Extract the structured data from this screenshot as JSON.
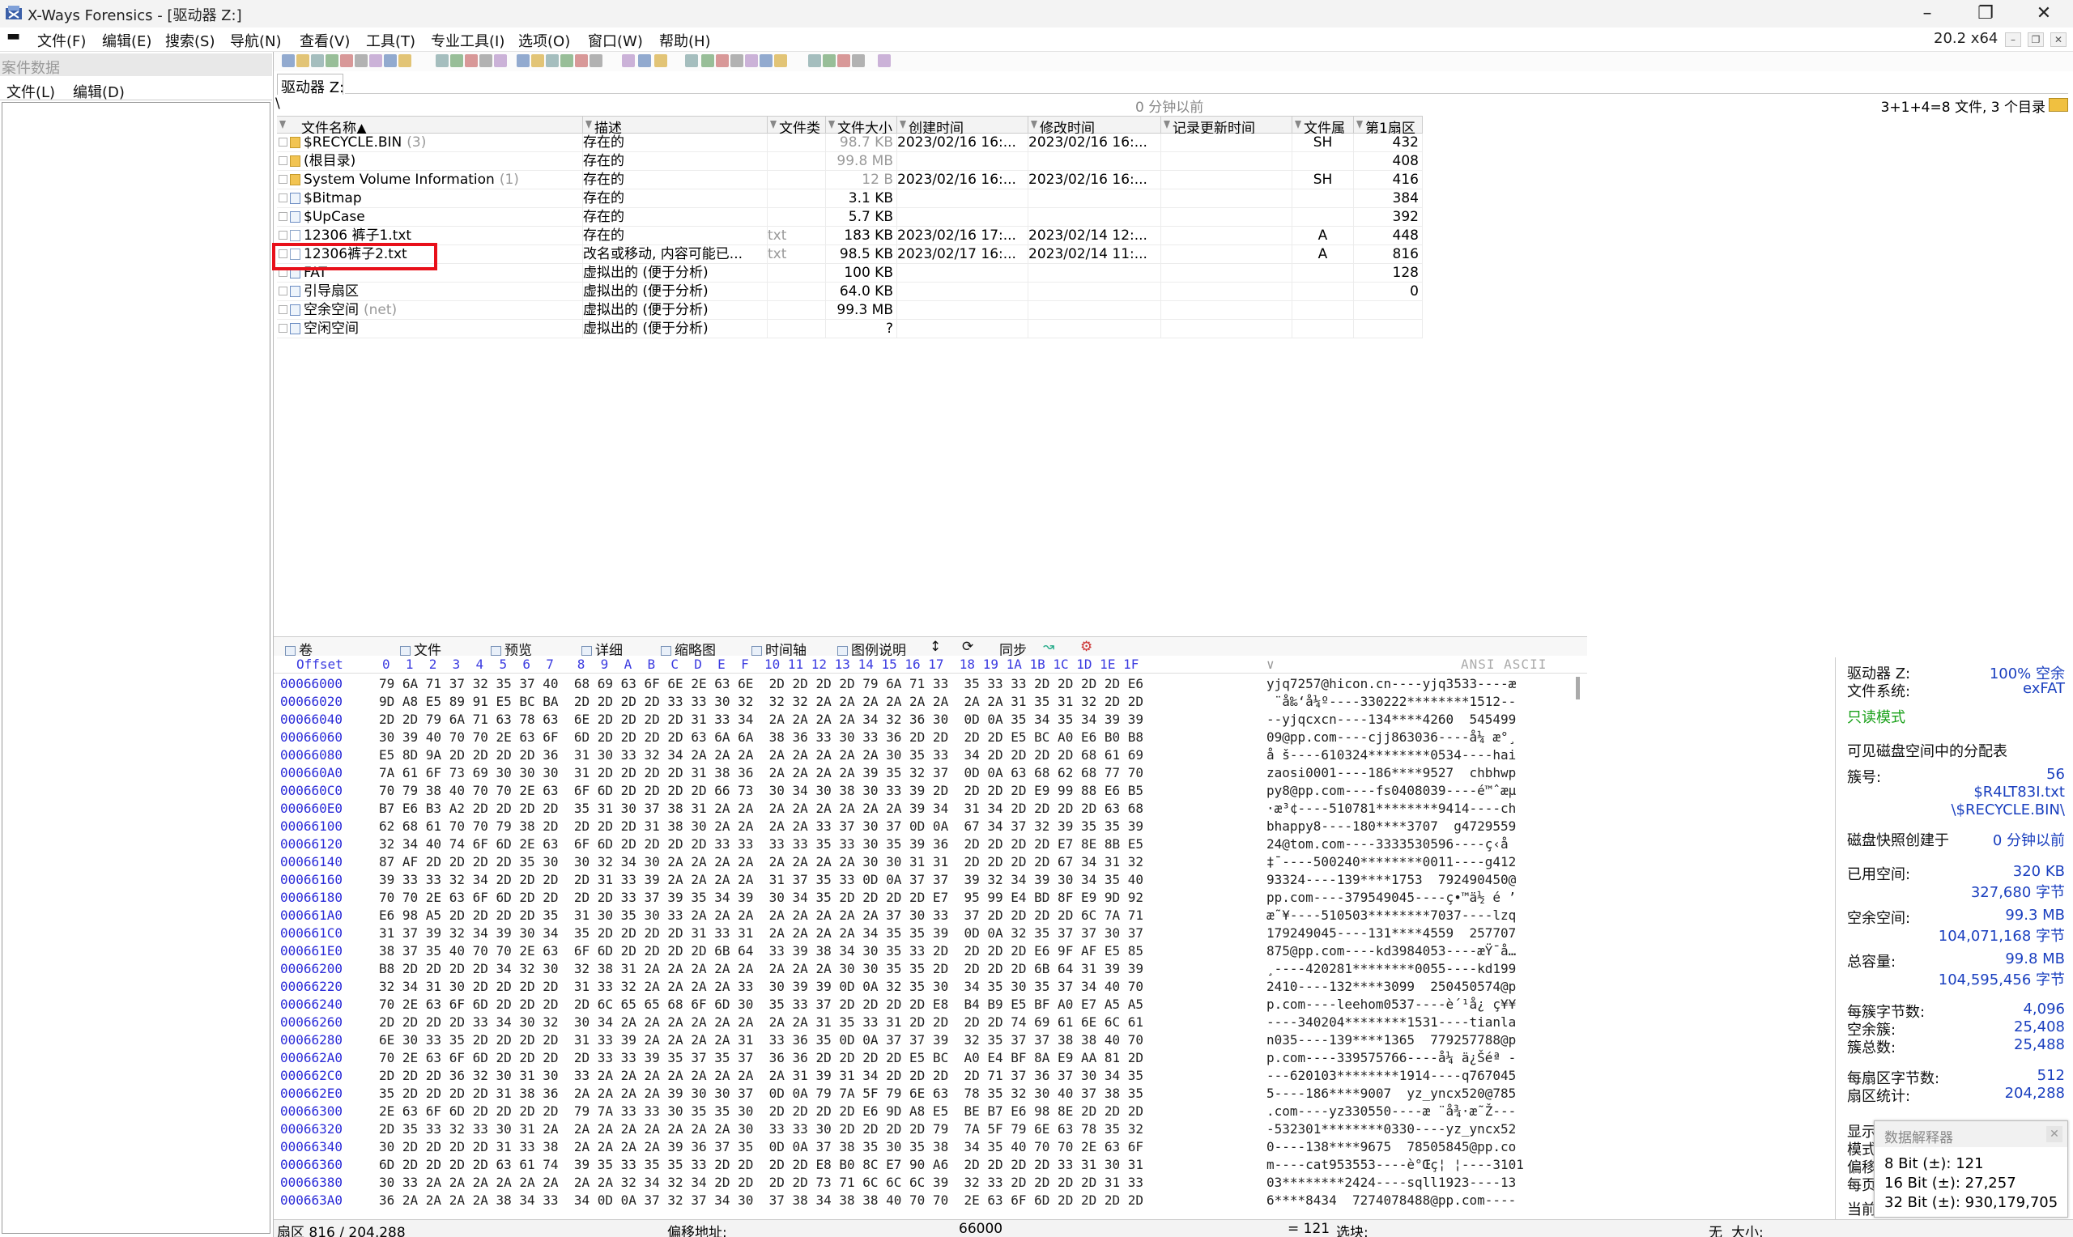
{
  "window": {
    "title": "X-Ways Forensics - [驱动器 Z:]",
    "minimize": "–",
    "maximize": "❐",
    "close": "✕",
    "version": "20.2 x64"
  },
  "menu": [
    "文件(F)",
    "编辑(E)",
    "搜索(S)",
    "导航(N)",
    "查看(V)",
    "工具(T)",
    "专业工具(I)",
    "选项(O)",
    "窗口(W)",
    "帮助(H)"
  ],
  "left_pane": {
    "header": "案件数据",
    "menu": [
      "文件(L)",
      "编辑(D)"
    ]
  },
  "path": {
    "drive_tab": "驱动器 Z:",
    "current": "\\",
    "ago": "0 分钟以前",
    "count": "3+1+4=8 文件, 3 个目录"
  },
  "file_table": {
    "headers": [
      "文件名称▲",
      "描述",
      "文件类",
      "文件大小",
      "创建时间",
      "修改时间",
      "记录更新时间",
      "文件属",
      "第1扇区"
    ],
    "rows": [
      {
        "name": "$RECYCLE.BIN",
        "extra": "(3)",
        "icon": "folder",
        "desc": "存在的",
        "type": "",
        "size": "98.7 KB",
        "size_grey": true,
        "created": "2023/02/16  16:...",
        "modified": "2023/02/16  16:...",
        "updated": "",
        "attr": "SH",
        "sector": "432"
      },
      {
        "name": "(根目录)",
        "extra": "",
        "icon": "folder",
        "desc": "存在的",
        "type": "",
        "size": "99.8 MB",
        "size_grey": true,
        "created": "",
        "modified": "",
        "updated": "",
        "attr": "",
        "sector": "408"
      },
      {
        "name": "System Volume Information",
        "extra": "(1)",
        "icon": "folder",
        "desc": "存在的",
        "type": "",
        "size": "12 B",
        "size_grey": true,
        "created": "2023/02/16  16:...",
        "modified": "2023/02/16  16:...",
        "updated": "",
        "attr": "SH",
        "sector": "416"
      },
      {
        "name": "$Bitmap",
        "extra": "",
        "icon": "virt",
        "desc": "存在的",
        "type": "",
        "size": "3.1 KB",
        "size_grey": false,
        "created": "",
        "modified": "",
        "updated": "",
        "attr": "",
        "sector": "384"
      },
      {
        "name": "$UpCase",
        "extra": "",
        "icon": "virt",
        "desc": "存在的",
        "type": "",
        "size": "5.7 KB",
        "size_grey": false,
        "created": "",
        "modified": "",
        "updated": "",
        "attr": "",
        "sector": "392"
      },
      {
        "name": "12306 裤子1.txt",
        "extra": "",
        "icon": "file",
        "desc": "存在的",
        "type": "txt",
        "size": "183 KB",
        "size_grey": false,
        "created": "2023/02/16  17:...",
        "modified": "2023/02/14  12:...",
        "updated": "",
        "attr": "A",
        "sector": "448"
      },
      {
        "name": "12306裤子2.txt",
        "extra": "",
        "icon": "file",
        "desc": "改名或移动, 内容可能已...",
        "type": "txt",
        "size": "98.5 KB",
        "size_grey": false,
        "created": "2023/02/17  16:...",
        "modified": "2023/02/14  11:...",
        "updated": "",
        "attr": "A",
        "sector": "816"
      },
      {
        "name": "FAT",
        "extra": "",
        "icon": "virt",
        "desc": "虚拟出的 (便于分析)",
        "type": "",
        "size": "100 KB",
        "size_grey": false,
        "created": "",
        "modified": "",
        "updated": "",
        "attr": "",
        "sector": "128"
      },
      {
        "name": "引导扇区",
        "extra": "",
        "icon": "virt",
        "desc": "虚拟出的 (便于分析)",
        "type": "",
        "size": "64.0 KB",
        "size_grey": false,
        "created": "",
        "modified": "",
        "updated": "",
        "attr": "",
        "sector": "0"
      },
      {
        "name": "空余空间",
        "extra": "(net)",
        "icon": "virt",
        "desc": "虚拟出的 (便于分析)",
        "type": "",
        "size": "99.3 MB",
        "size_grey": false,
        "created": "",
        "modified": "",
        "updated": "",
        "attr": "",
        "sector": ""
      },
      {
        "name": "空闲空间",
        "extra": "",
        "icon": "virt",
        "desc": "虚拟出的 (便于分析)",
        "type": "",
        "size": "?",
        "size_grey": false,
        "created": "",
        "modified": "",
        "updated": "",
        "attr": "",
        "sector": ""
      }
    ]
  },
  "lower_tabs": [
    "卷",
    "文件",
    "预览",
    "详细",
    "缩略图",
    "时间轴",
    "图例说明",
    "同步"
  ],
  "hex": {
    "header": "Offset     0  1  2  3  4  5  6  7   8  9  A  B  C  D  E  F  10 11 12 13 14 15 16 17  18 19 1A 1B 1C 1D 1E 1F",
    "ascii_header": "ANSI ASCII",
    "rows": [
      {
        "off": "00066000",
        "hex": "79 6A 71 37 32 35 37 40  68 69 63 6F 6E 2E 63 6E  2D 2D 2D 2D 79 6A 71 33  35 33 33 2D 2D 2D 2D E6",
        "asc": "yjq7257@hicon.cn----yjq3533----æ"
      },
      {
        "off": "00066020",
        "hex": "9D A8 E5 89 91 E5 BC BA  2D 2D 2D 2D 33 33 30 32  32 32 2A 2A 2A 2A 2A 2A  2A 2A 31 35 31 32 2D 2D",
        "asc": " ¨å‰‘å¼º----330222********1512--"
      },
      {
        "off": "00066040",
        "hex": "2D 2D 79 6A 71 63 78 63  6E 2D 2D 2D 2D 31 33 34  2A 2A 2A 2A 34 32 36 30  0D 0A 35 34 35 34 39 39",
        "asc": "--yjqcxcn----134****4260  545499"
      },
      {
        "off": "00066060",
        "hex": "30 39 40 70 70 2E 63 6F  6D 2D 2D 2D 2D 63 6A 6A  38 36 33 30 33 36 2D 2D  2D 2D E5 BC A0 E6 B0 B8",
        "asc": "09@pp.com----cjj863036----å¼ æ°¸"
      },
      {
        "off": "00066080",
        "hex": "E5 8D 9A 2D 2D 2D 2D 36  31 30 33 32 34 2A 2A 2A  2A 2A 2A 2A 2A 30 35 33  34 2D 2D 2D 2D 68 61 69",
        "asc": "å š----610324********0534----hai"
      },
      {
        "off": "000660A0",
        "hex": "7A 61 6F 73 69 30 30 30  31 2D 2D 2D 2D 31 38 36  2A 2A 2A 2A 39 35 32 37  0D 0A 63 68 62 68 77 70",
        "asc": "zaosi0001----186****9527  chbhwp"
      },
      {
        "off": "000660C0",
        "hex": "70 79 38 40 70 70 2E 63  6F 6D 2D 2D 2D 2D 66 73  30 34 30 38 30 33 39 2D  2D 2D 2D E9 99 88 E6 B5",
        "asc": "py8@pp.com----fs0408039----é™ˆæµ"
      },
      {
        "off": "000660E0",
        "hex": "B7 E6 B3 A2 2D 2D 2D 2D  35 31 30 37 38 31 2A 2A  2A 2A 2A 2A 2A 2A 39 34  31 34 2D 2D 2D 2D 63 68",
        "asc": "·æ³¢----510781********9414----ch"
      },
      {
        "off": "00066100",
        "hex": "62 68 61 70 70 79 38 2D  2D 2D 2D 31 38 30 2A 2A  2A 2A 33 37 30 37 0D 0A  67 34 37 32 39 35 35 39",
        "asc": "bhappy8----180****3707  g4729559"
      },
      {
        "off": "00066120",
        "hex": "32 34 40 74 6F 6D 2E 63  6F 6D 2D 2D 2D 2D 33 33  33 33 35 33 30 35 39 36  2D 2D 2D 2D E7 8E 8B E5",
        "asc": "24@tom.com----3333530596----ç‹å"
      },
      {
        "off": "00066140",
        "hex": "87 AF 2D 2D 2D 2D 35 30  30 32 34 30 2A 2A 2A 2A  2A 2A 2A 2A 30 30 31 31  2D 2D 2D 2D 67 34 31 32",
        "asc": "‡¯----500240********0011----g412"
      },
      {
        "off": "00066160",
        "hex": "39 33 33 32 34 2D 2D 2D  2D 31 33 39 2A 2A 2A 2A  31 37 35 33 0D 0A 37 37  39 32 34 39 30 34 35 40",
        "asc": "93324----139****1753  792490450@"
      },
      {
        "off": "00066180",
        "hex": "70 70 2E 63 6F 6D 2D 2D  2D 2D 33 37 39 35 34 39  30 34 35 2D 2D 2D 2D E7  95 99 E4 BD 8F E9 9D 92",
        "asc": "pp.com----379549045----ç•™ä½ é ’"
      },
      {
        "off": "000661A0",
        "hex": "E6 98 A5 2D 2D 2D 2D 35  31 30 35 30 33 2A 2A 2A  2A 2A 2A 2A 2A 37 30 33  37 2D 2D 2D 2D 6C 7A 71",
        "asc": "æ˜¥----510503********7037----lzq"
      },
      {
        "off": "000661C0",
        "hex": "31 37 39 32 34 39 30 34  35 2D 2D 2D 2D 31 33 31  2A 2A 2A 2A 34 35 35 39  0D 0A 32 35 37 37 30 37",
        "asc": "179249045----131****4559  257707"
      },
      {
        "off": "000661E0",
        "hex": "38 37 35 40 70 70 2E 63  6F 6D 2D 2D 2D 2D 6B 64  33 39 38 34 30 35 33 2D  2D 2D 2D E6 9F AF E5 85",
        "asc": "875@pp.com----kd3984053----æŸ¯å…"
      },
      {
        "off": "00066200",
        "hex": "B8 2D 2D 2D 2D 34 32 30  32 38 31 2A 2A 2A 2A 2A  2A 2A 2A 30 30 35 35 2D  2D 2D 2D 6B 64 31 39 39",
        "asc": "¸----420281********0055----kd199"
      },
      {
        "off": "00066220",
        "hex": "32 34 31 30 2D 2D 2D 2D  31 33 32 2A 2A 2A 2A 33  30 39 39 0D 0A 32 35 30  34 35 30 35 37 34 40 70",
        "asc": "2410----132****3099  250450574@p"
      },
      {
        "off": "00066240",
        "hex": "70 2E 63 6F 6D 2D 2D 2D  2D 6C 65 65 68 6F 6D 30  35 33 37 2D 2D 2D 2D E8  B4 B9 E5 BF A0 E7 A5 A5",
        "asc": "p.com----leehom0537----è´¹å¿ ç¥¥"
      },
      {
        "off": "00066260",
        "hex": "2D 2D 2D 2D 33 34 30 32  30 34 2A 2A 2A 2A 2A 2A  2A 2A 31 35 33 31 2D 2D  2D 2D 74 69 61 6E 6C 61",
        "asc": "----340204********1531----tianla"
      },
      {
        "off": "00066280",
        "hex": "6E 30 33 35 2D 2D 2D 2D  31 33 39 2A 2A 2A 2A 31  33 36 35 0D 0A 37 37 39  32 35 37 37 38 38 40 70",
        "asc": "n035----139****1365  779257788@p"
      },
      {
        "off": "000662A0",
        "hex": "70 2E 63 6F 6D 2D 2D 2D  2D 33 33 39 35 37 35 37  36 36 2D 2D 2D 2D E5 BC  A0 E4 BF 8A E9 AA 81 2D",
        "asc": "p.com----339575766----å¼ ä¿Šéª -"
      },
      {
        "off": "000662C0",
        "hex": "2D 2D 2D 36 32 30 31 30  33 2A 2A 2A 2A 2A 2A 2A  2A 31 39 31 34 2D 2D 2D  2D 71 37 36 37 30 34 35",
        "asc": "---620103********1914----q767045"
      },
      {
        "off": "000662E0",
        "hex": "35 2D 2D 2D 2D 31 38 36  2A 2A 2A 2A 39 30 30 37  0D 0A 79 7A 5F 79 6E 63  78 35 32 30 40 37 38 35",
        "asc": "5----186****9007  yz_yncx520@785"
      },
      {
        "off": "00066300",
        "hex": "2E 63 6F 6D 2D 2D 2D 2D  79 7A 33 33 30 35 35 30  2D 2D 2D 2D E6 9D A8 E5  BE B7 E6 98 8E 2D 2D 2D",
        "asc": ".com----yz330550----æ ¨å¾·æ˜Ž---"
      },
      {
        "off": "00066320",
        "hex": "2D 35 33 32 33 30 31 2A  2A 2A 2A 2A 2A 2A 2A 30  33 33 30 2D 2D 2D 2D 79  7A 5F 79 6E 63 78 35 32",
        "asc": "-532301********0330----yz_yncx52"
      },
      {
        "off": "00066340",
        "hex": "30 2D 2D 2D 2D 31 33 38  2A 2A 2A 2A 39 36 37 35  0D 0A 37 38 35 30 35 38  34 35 40 70 70 2E 63 6F",
        "asc": "0----138****9675  78505845@pp.co"
      },
      {
        "off": "00066360",
        "hex": "6D 2D 2D 2D 2D 63 61 74  39 35 33 35 35 33 2D 2D  2D 2D E8 B0 8C E7 90 A6  2D 2D 2D 2D 33 31 30 31",
        "asc": "m----cat953553----è°Œç¦ ¦----3101"
      },
      {
        "off": "00066380",
        "hex": "30 33 2A 2A 2A 2A 2A 2A  2A 2A 32 34 32 34 2D 2D  2D 2D 73 71 6C 6C 6C 39  32 33 2D 2D 2D 2D 31 33",
        "asc": "03********2424----sqll1923----13"
      },
      {
        "off": "000663A0",
        "hex": "36 2A 2A 2A 2A 38 34 33  34 0D 0A 37 32 37 34 30  37 38 34 38 38 40 70 70  2E 63 6F 6D 2D 2D 2D 2D",
        "asc": "6****8434  7274078488@pp.com----"
      }
    ]
  },
  "info_pane": {
    "drive_label": "驱动器 Z:",
    "drive_value": "100% 空余",
    "fs_label": "文件系统:",
    "fs_value": "exFAT",
    "mode": "只读模式",
    "alloc_title": "可见磁盘空间中的分配表",
    "cluster_label": "簇号:",
    "cluster_value": "56",
    "path1": "$R4LT83I.txt",
    "path2": "\\$RECYCLE.BIN\\",
    "snap_label": "磁盘快照创建于",
    "snap_value": "0 分钟以前",
    "used_label": "已用空间:",
    "used_value1": "320 KB",
    "used_value2": "327,680 字节",
    "free_label": "空余空间:",
    "free_value1": "99.3 MB",
    "free_value2": "104,071,168 字节",
    "total_label": "总容量:",
    "total_value1": "99.8 MB",
    "total_value2": "104,595,456 字节",
    "bpc_label": "每簇字节数:",
    "bpc_value": "4,096",
    "freec_label": "空余簇:",
    "freec_value": "25,408",
    "totc_label": "簇总数:",
    "totc_value": "25,488",
    "bps_label": "每扇区字节数:",
    "bps_value": "512",
    "sec_label": "扇区统计:",
    "sec_value": "204,288",
    "partial": [
      "显示",
      "模式",
      "偏移",
      "每页",
      "当前"
    ]
  },
  "data_interpreter": {
    "title": "数据解释器",
    "close": "✕",
    "bit8": "8 Bit (±): 121",
    "bit16": "16 Bit (±): 27,257",
    "bit32": "32 Bit (±): 930,179,705"
  },
  "status": {
    "sector": "扇区 816 / 204,288",
    "offset_label": "偏移地址:",
    "offset_value": "66000",
    "eq": "= 121",
    "sel_label": "选块:",
    "none": "无",
    "size_label": "大小:"
  }
}
